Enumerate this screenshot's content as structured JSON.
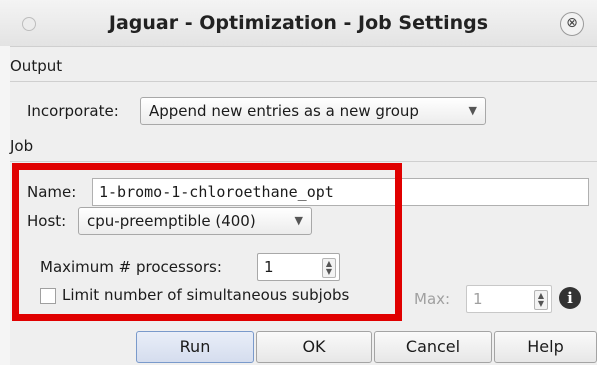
{
  "window": {
    "title": "Jaguar - Optimization - Job Settings",
    "close_glyph": "⊗",
    "left_icon": "circle-icon"
  },
  "output": {
    "section_label": "Output",
    "incorporate_label": "Incorporate:",
    "incorporate_value": "Append new entries as a new group"
  },
  "job": {
    "section_label": "Job",
    "name_label": "Name:",
    "name_value": "1-bromo-1-chloroethane_opt",
    "host_label": "Host:",
    "host_value": "cpu-preemptible (400)",
    "max_processors_label": "Maximum # processors:",
    "max_processors_value": "1",
    "limit_subjobs_label": "Limit number of simultaneous subjobs",
    "limit_subjobs_checked": false,
    "max_label": "Max:",
    "max_value": "1",
    "info_glyph": "i"
  },
  "buttons": {
    "run": "Run",
    "ok": "OK",
    "cancel": "Cancel",
    "help": "Help"
  },
  "colors": {
    "highlight": "#e00000"
  }
}
